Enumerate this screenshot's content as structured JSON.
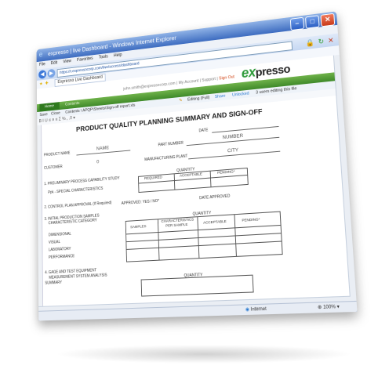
{
  "window": {
    "title": "expresso | live Dashboard - Windows Internet Explorer",
    "controls": {
      "minimize": "–",
      "maximize": "□",
      "close": "✕"
    }
  },
  "browser": {
    "menu": [
      "File",
      "Edit",
      "View",
      "Favorites",
      "Tools",
      "Help"
    ],
    "address": "https://r.expressocorp.com/live/access/dashboard",
    "favorite_tab": "Expresso Live Dashboard"
  },
  "app": {
    "user_email": "john.smith@expressocorp.com",
    "account_link": "My Account",
    "support_link": "Support",
    "signout_link": "Sign Out",
    "logo_x": "ex",
    "logo_rest": "presso",
    "tabs": [
      "Home",
      "Contents"
    ],
    "toolbar": {
      "item1": "Save",
      "item2": "Close",
      "path": "Contents \\ APQP\\Sheets\\Sign-off report.xls",
      "editing": "Editing (Full)",
      "share": "Share",
      "lock_state": "Unlocked",
      "users": "3 users editing this file"
    },
    "format_glyphs": "B  I  U   ≡  ≡  ≡   Σ  %  ,  .0  ▾"
  },
  "document": {
    "title": "PRODUCT QUALITY PLANNING SUMMARY AND SIGN-OFF",
    "date_label": "DATE",
    "product_name_label": "PRODUCT NAME",
    "product_name_value": "NAME",
    "part_number_label": "PART NUMBER",
    "part_number_value": "NUMBER",
    "customer_label": "CUSTOMER",
    "customer_value": "0",
    "plant_label": "MANUFACTURING PLANT",
    "plant_value": "CITY",
    "section1": "1.  PRELIMINARY PROCESS CAPABILITY STUDY",
    "section1a": "Ppk - SPECIAL CHARACTERISTICS",
    "quantity_label": "QUANTITY",
    "required": "REQUIRED",
    "acceptable": "ACCEPTABLE",
    "pending": "PENDING*",
    "section2": "2.  CONTROL PLAN APPROVAL (If Required)",
    "approved_label": "APPROVED: YES / NO*",
    "date_approved_label": "DATE APPROVED",
    "section3": "3.  INITIAL PRODUCTION SAMPLES",
    "section3_sub": "CHARACTERISTIC CATEGORY",
    "quantity2_label": "QUANTITY",
    "samples": "SAMPLES",
    "characteristics": "CHARACTERISTICS",
    "per_sample": "PER SAMPLE",
    "acceptable2": "ACCEPTABLE",
    "pending2": "PENDING*",
    "rows": [
      "DIMENSIONAL",
      "VISUAL",
      "LABORATORY",
      "PERFORMANCE"
    ],
    "section4": "4.  GAGE AND TEST EQUIPMENT",
    "section4_sub": "MEASUREMENT SYSTEM ANALYSIS",
    "section4_sub2": "SUMMARY",
    "quantity3_label": "QUANTITY"
  },
  "status": {
    "zone": "Internet",
    "zoom": "100%"
  }
}
